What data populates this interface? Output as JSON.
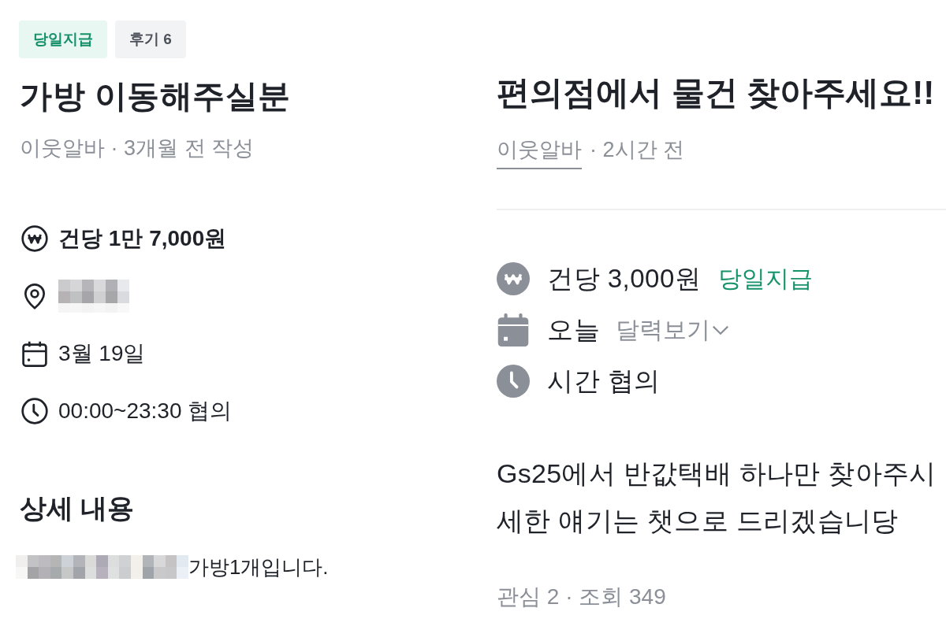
{
  "left_post": {
    "tags": [
      {
        "label": "당일지급",
        "kind": "highlight"
      },
      {
        "label": "후기 6",
        "kind": "plain"
      }
    ],
    "title": "가방 이동해주실분",
    "meta": "이웃알바 · 3개월 전 작성",
    "info": [
      {
        "kind": "pay",
        "text": "건당 1만 7,000원"
      },
      {
        "kind": "location",
        "redacted": true
      },
      {
        "kind": "date",
        "text": "3월 19일"
      },
      {
        "kind": "time",
        "text": "00:00~23:30 협의"
      }
    ],
    "details": {
      "heading": "상세 내용",
      "redacted_prefix": true,
      "text": "가방1개입니다."
    }
  },
  "right_post": {
    "title": "편의점에서 물건 찾아주세요!!",
    "author": "이웃알바",
    "posted": "· 2시간 전",
    "info": [
      {
        "kind": "pay",
        "text": "건당 3,000원",
        "badge": "당일지급"
      },
      {
        "kind": "date",
        "text": "오늘",
        "link": "달력보기"
      },
      {
        "kind": "time",
        "text": "시간 협의"
      }
    ],
    "body_lines": [
      "Gs25에서 반값택배 하나만 찾아주시",
      "세한 얘기는 챗으로 드리겠습니당"
    ],
    "stats": "관심 2 · 조회 349"
  }
}
